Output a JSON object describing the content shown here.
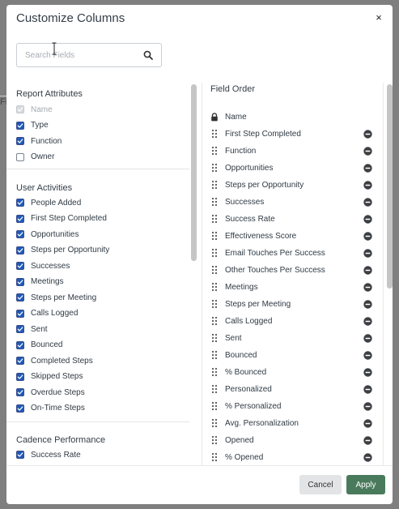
{
  "modal": {
    "title": "Customize Columns",
    "close_label": "×"
  },
  "search": {
    "placeholder": "Search Fields"
  },
  "background": {
    "partial_text": "Fi"
  },
  "sections": [
    {
      "title": "Report Attributes",
      "items": [
        {
          "label": "Name",
          "state": "disabled"
        },
        {
          "label": "Type",
          "state": "checked"
        },
        {
          "label": "Function",
          "state": "checked"
        },
        {
          "label": "Owner",
          "state": "unchecked"
        }
      ]
    },
    {
      "title": "User Activities",
      "items": [
        {
          "label": "People Added",
          "state": "checked"
        },
        {
          "label": "First Step Completed",
          "state": "checked"
        },
        {
          "label": "Opportunities",
          "state": "checked"
        },
        {
          "label": "Steps per Opportunity",
          "state": "checked"
        },
        {
          "label": "Successes",
          "state": "checked"
        },
        {
          "label": "Meetings",
          "state": "checked"
        },
        {
          "label": "Steps per Meeting",
          "state": "checked"
        },
        {
          "label": "Calls Logged",
          "state": "checked"
        },
        {
          "label": "Sent",
          "state": "checked"
        },
        {
          "label": "Bounced",
          "state": "checked"
        },
        {
          "label": "Completed Steps",
          "state": "checked"
        },
        {
          "label": "Skipped Steps",
          "state": "checked"
        },
        {
          "label": "Overdue Steps",
          "state": "checked"
        },
        {
          "label": "On-Time Steps",
          "state": "checked"
        }
      ]
    },
    {
      "title": "Cadence Performance",
      "items": [
        {
          "label": "Success Rate",
          "state": "checked"
        },
        {
          "label": "Effectiveness Score",
          "state": "checked"
        }
      ]
    }
  ],
  "field_order": {
    "title": "Field Order",
    "locked": {
      "label": "Name"
    },
    "items": [
      "First Step Completed",
      "Function",
      "Opportunities",
      "Steps per Opportunity",
      "Successes",
      "Success Rate",
      "Effectiveness Score",
      "Email Touches Per Success",
      "Other Touches Per Success",
      "Meetings",
      "Steps per Meeting",
      "Calls Logged",
      "Sent",
      "Bounced",
      "% Bounced",
      "Personalized",
      "% Personalized",
      "Avg. Personalization",
      "Opened",
      "% Opened",
      ""
    ]
  },
  "footer": {
    "cancel_label": "Cancel",
    "apply_label": "Apply"
  },
  "colors": {
    "checkbox": "#1e5bb8",
    "apply_button": "#4a7a5c",
    "overlay": "#7f7f7f"
  }
}
